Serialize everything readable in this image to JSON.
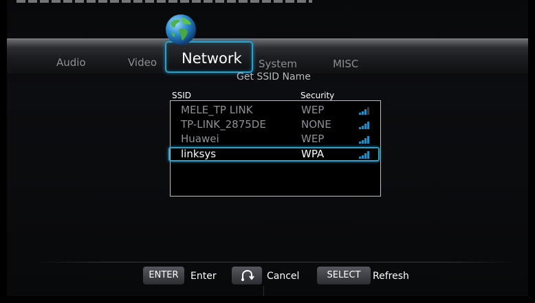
{
  "tabs": {
    "audio": "Audio",
    "video": "Video",
    "network": "Network",
    "system": "System",
    "misc": "MISC"
  },
  "subtitle": "Get SSID Name",
  "columns": {
    "ssid": "SSID",
    "security": "Security"
  },
  "networks": [
    {
      "ssid": "MELE_TP LINK",
      "security": "WEP",
      "signal_bars": 3
    },
    {
      "ssid": "TP-LINK_2875DE",
      "security": "NONE",
      "signal_bars": 4
    },
    {
      "ssid": "Huawei",
      "security": "WEP",
      "signal_bars": 4
    },
    {
      "ssid": "linksys",
      "security": "WPA",
      "signal_bars": 4,
      "selected": true
    }
  ],
  "footer": {
    "enter_key": "ENTER",
    "enter_label": "Enter",
    "cancel_label": "Cancel",
    "select_key": "SELECT",
    "refresh_label": "Refresh"
  },
  "colors": {
    "accent": "#2ea0c9",
    "signal": "#1f8fbf"
  },
  "icons": {
    "network_tab": "globe-icon",
    "cancel_key": "return-arrow-icon",
    "signal": "signal-strength-icon"
  }
}
